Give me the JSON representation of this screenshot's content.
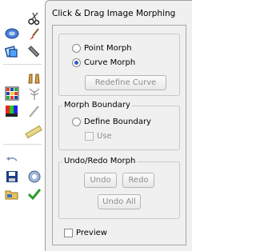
{
  "toolbar": {
    "tools": [
      {
        "name": "scissors-icon"
      },
      {
        "name": "lasso-icon"
      },
      {
        "name": "brush-icon"
      },
      {
        "name": "layer-select-icon"
      },
      {
        "name": "pencil-icon"
      },
      {
        "name": "morph-hands-icon"
      },
      {
        "name": "grid-icon"
      },
      {
        "name": "tree-icon"
      },
      {
        "name": "color-swatch-icon"
      },
      {
        "name": "eyedropper-icon"
      },
      {
        "name": "ruler-icon"
      },
      {
        "name": "undo-arrow-icon"
      },
      {
        "name": "save-icon"
      },
      {
        "name": "settings-icon"
      },
      {
        "name": "open-folder-icon"
      },
      {
        "name": "checkmark-icon"
      }
    ]
  },
  "panel": {
    "title": "Click & Drag Image Morphing",
    "morph_type": {
      "point_label": "Point Morph",
      "curve_label": "Curve Morph",
      "selected": "curve",
      "redefine_label": "Redefine Curve"
    },
    "boundary": {
      "group_label": "Morph Boundary",
      "define_label": "Define Boundary",
      "use_label": "Use"
    },
    "undo": {
      "group_label": "Undo/Redo Morph",
      "undo_label": "Undo",
      "redo_label": "Redo",
      "undo_all_label": "Undo All"
    },
    "preview_label": "Preview"
  },
  "colors": {
    "panel_bg": "#f0f0f0",
    "radio_dot": "#2a5fbf",
    "disabled_text": "#8d8d8d",
    "check_green": "#2e9b2e"
  }
}
